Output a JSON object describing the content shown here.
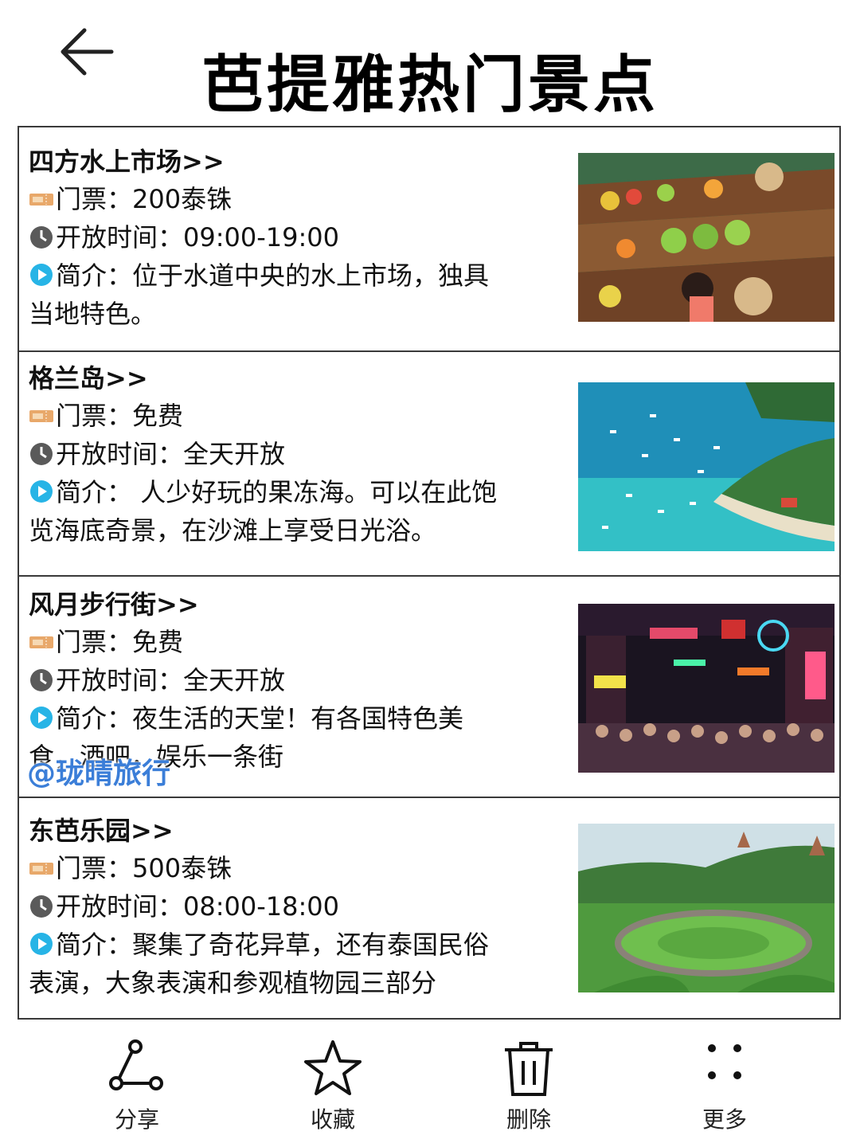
{
  "header": {
    "title": "芭提雅热门景点"
  },
  "ticket_label": "门票：",
  "hours_label": "开放时间：",
  "intro_label": "简介：",
  "attractions": [
    {
      "name": "四方水上市场>>",
      "ticket": "200泰铢",
      "hours": "09:00-19:00",
      "intro": "位于水道中央的水上市场，独具当地特色。"
    },
    {
      "name": "格兰岛>>",
      "ticket": "免费",
      "hours": "全天开放",
      "intro": " 人少好玩的果冻海。可以在此饱览海底奇景，在沙滩上享受日光浴。"
    },
    {
      "name": "风月步行街>>",
      "ticket": "免费",
      "hours": "全天开放",
      "intro": "夜生活的天堂！有各国特色美食，酒吧，娱乐一条街"
    },
    {
      "name": "东芭乐园>>",
      "ticket": "500泰铢",
      "hours": "08:00-18:00",
      "intro": "聚集了奇花异草，还有泰国民俗表演，大象表演和参观植物园三部分"
    }
  ],
  "watermark": "@珑晴旅行",
  "toolbar": {
    "share": "分享",
    "favorite": "收藏",
    "delete": "删除",
    "more": "更多"
  },
  "icons": {
    "back": "back-arrow-icon",
    "ticket": "ticket-icon",
    "clock": "clock-icon",
    "play": "play-icon",
    "share": "share-icon",
    "favorite": "star-icon",
    "delete": "trash-icon",
    "more": "more-dots-icon"
  },
  "colors": {
    "ticket_icon": "#e8a86a",
    "clock_icon": "#5a5a5a",
    "play_icon": "#27b4e6",
    "watermark": "#3b7ed8",
    "border": "#3a3a3a"
  }
}
